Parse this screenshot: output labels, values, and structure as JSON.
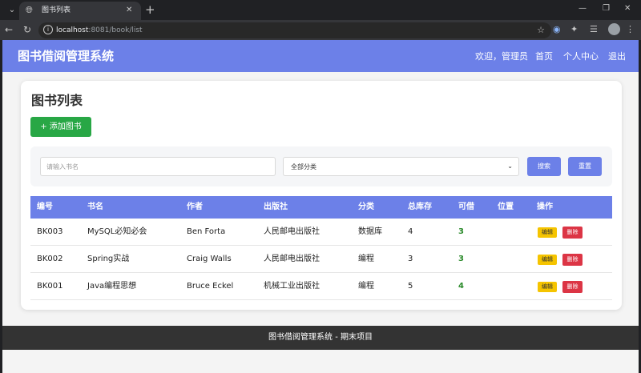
{
  "browser": {
    "tab_title": "图书列表",
    "tab_close": "✕",
    "new_tab": "+",
    "url_host": "localhost",
    "url_rest": ":8081/book/list",
    "icons": [
      "tab-menu-icon",
      "globe-icon",
      "close-icon",
      "plus-icon",
      "back-icon",
      "reload-icon",
      "info-icon",
      "star-icon",
      "extension-icon",
      "puzzle-icon",
      "reading-list-icon",
      "avatar",
      "more-icon"
    ]
  },
  "header": {
    "title": "图书借阅管理系统",
    "nav": {
      "welcome": "欢迎，管理员",
      "home": "首页",
      "profile": "个人中心",
      "logout": "退出"
    }
  },
  "main": {
    "title": "图书列表",
    "add_button": "+ 添加图书",
    "search": {
      "placeholder": "请输入书名",
      "category_selected": "全部分类",
      "search_button": "搜索",
      "reset_button": "重置"
    },
    "table": {
      "columns": [
        "编号",
        "书名",
        "作者",
        "出版社",
        "分类",
        "总库存",
        "可借",
        "位置",
        "操作"
      ],
      "rows": [
        {
          "id": "BK003",
          "title": "MySQL必知必会",
          "author": "Ben Forta",
          "publisher": "人民邮电出版社",
          "category": "数据库",
          "total": "4",
          "available": "3",
          "location": ""
        },
        {
          "id": "BK002",
          "title": "Spring实战",
          "author": "Craig Walls",
          "publisher": "人民邮电出版社",
          "category": "编程",
          "total": "3",
          "available": "3",
          "location": ""
        },
        {
          "id": "BK001",
          "title": "Java编程思想",
          "author": "Bruce Eckel",
          "publisher": "机械工业出版社",
          "category": "编程",
          "total": "5",
          "available": "4",
          "location": ""
        }
      ],
      "edit_label": "编辑",
      "delete_label": "删除"
    }
  },
  "footer": {
    "text": "图书借阅管理系统 - 期末项目"
  },
  "colors": {
    "primary": "#6c80e8",
    "success": "#28a745",
    "warning": "#f5c400",
    "danger": "#dc3545",
    "available": "#2a8a2a",
    "footer": "#333333"
  }
}
